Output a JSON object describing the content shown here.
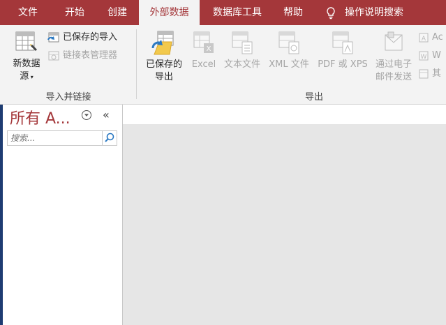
{
  "tabs": [
    "文件",
    "开始",
    "创建",
    "外部数据",
    "数据库工具",
    "帮助"
  ],
  "tell_me": "操作说明搜索",
  "ribbon": {
    "import_group": {
      "label": "导入并链接",
      "new_source": "新数据源",
      "new_source_line1": "新数据",
      "new_source_line2": "源",
      "saved_imports": "已保存的导入",
      "linked_table_manager": "链接表管理器"
    },
    "export_group": {
      "label": "导出",
      "saved_exports": "已保存的导出",
      "saved_exports_line1": "已保存的",
      "saved_exports_line2": "导出",
      "excel": "Excel",
      "text_file": "文本文件",
      "xml_file": "XML 文件",
      "pdf_xps": "PDF 或 XPS",
      "email_line1": "通过电子",
      "email_line2": "邮件发送",
      "access_partial": "Ac",
      "word_partial": "W",
      "other_partial": "其"
    }
  },
  "nav_pane": {
    "title": "所有 A...",
    "collapse": "«",
    "search_placeholder": "搜索..."
  },
  "colors": {
    "accent": "#a4373a",
    "ribbon_bg": "#f3f3f3",
    "workspace_bg": "#e6e6e6",
    "icon_blue": "#2b79c2",
    "disabled_text": "#a6a6a6"
  }
}
